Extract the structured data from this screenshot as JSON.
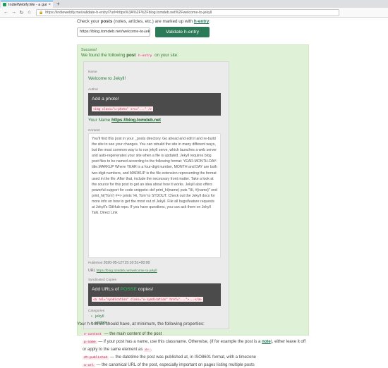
{
  "browser": {
    "tab_title": "IndieWebify.Me - a guide",
    "tab_close": "×",
    "new_tab": "+",
    "url": "https://indiewebify.me/validate-h-entry/?url=https%3A%2F%2Fblog.tomdeb.net%2Fwelcome-to-jekyll"
  },
  "form": {
    "instruction_prefix": "Check your",
    "instruction_posts": "posts",
    "instruction_mid": "(notes, articles, etc.) are marked up with",
    "instruction_link": "h-entry",
    "instruction_suffix": ":",
    "url_value": "https://blog.tomdeb.net/welcome-to-jekyll",
    "validate_label": "Validate h-entry"
  },
  "result": {
    "status": "Success!",
    "found_prefix": "We found the following",
    "found_post": "post",
    "found_code": "h-entry",
    "found_suffix": "on your site:",
    "name_label": "Name",
    "name_value": "Welcome to Jekyll!",
    "author_label": "Author",
    "author_title": "Add a photo!",
    "author_code": "<img class=\"u-photo\" src=\"...\" />",
    "author_name_prefix": "Your Name",
    "author_link": "https://blog.tomdeb.net",
    "content_label": "Content",
    "content_text": "You'll find this post in your _posts directory. Go ahead and edit it and re-build the site to see your changes. You can rebuild the site in many different ways, but the most common way is to run jekyll serve, which launches a web server and auto-regenerates your site when a file is updated. Jekyll requires blog post files to be named according to the following format: YEAR-MONTH-DAY-title.MARKUP Where YEAR is a four-digit number, MONTH and DAY are both two-digit numbers, and MARKUP is the file extension representing the format used in the file. After that, include the necessary front matter. Take a look at the source for this post to get an idea about how it works. Jekyll also offers powerful support for code snippets: def print_hi(name) puts \"Hi, #{name}\" end print_hi('Tom') #=> prints 'Hi, Tom' to STDOUT. Check out the Jekyll docs for more info on how to get the most out of Jekyll. File all bugs/feature requests at Jekyll's GitHub repo. If you have questions, you can ask them on Jekyll Talk. Direct Link",
    "published_label": "Published",
    "published_value": "2020-05-12T15:10:51+00:00",
    "url_label": "URL",
    "url_value": "https://blog.tomdeb.net/welcome-to-jekyll",
    "syndicated_label": "Syndicated Copies",
    "syndicated_prefix": "Add URLs of",
    "syndicated_highlight": "POSSE",
    "syndicated_suffix": "copies!",
    "syndicated_code": "<a rel=\"syndication\" class=\"u-syndication\" href=\"...\">...</a>",
    "categories_label": "Categories",
    "categories": [
      "jekyll",
      "update"
    ]
  },
  "properties": {
    "intro": "Your h-entries should have, at minimum, the following properties:",
    "items": [
      {
        "code": "e-content",
        "text": "— the main content of the post"
      },
      {
        "code": "p-name",
        "text_a": "— if your post has a name, use this classname. Otherwise, (if for example the post is a",
        "link": "note",
        "text_b": "), either leave it off",
        "cont_a": "or apply to the same element as",
        "cont_code": "e-",
        "cont_b": "."
      },
      {
        "code": "dt-published",
        "text": "— the datetime the post was published at, in ISO8601 format, with a timezone"
      },
      {
        "code": "u-url",
        "text": "— the canonical URL of the post, especially important on pages listing multiple posts"
      }
    ]
  }
}
